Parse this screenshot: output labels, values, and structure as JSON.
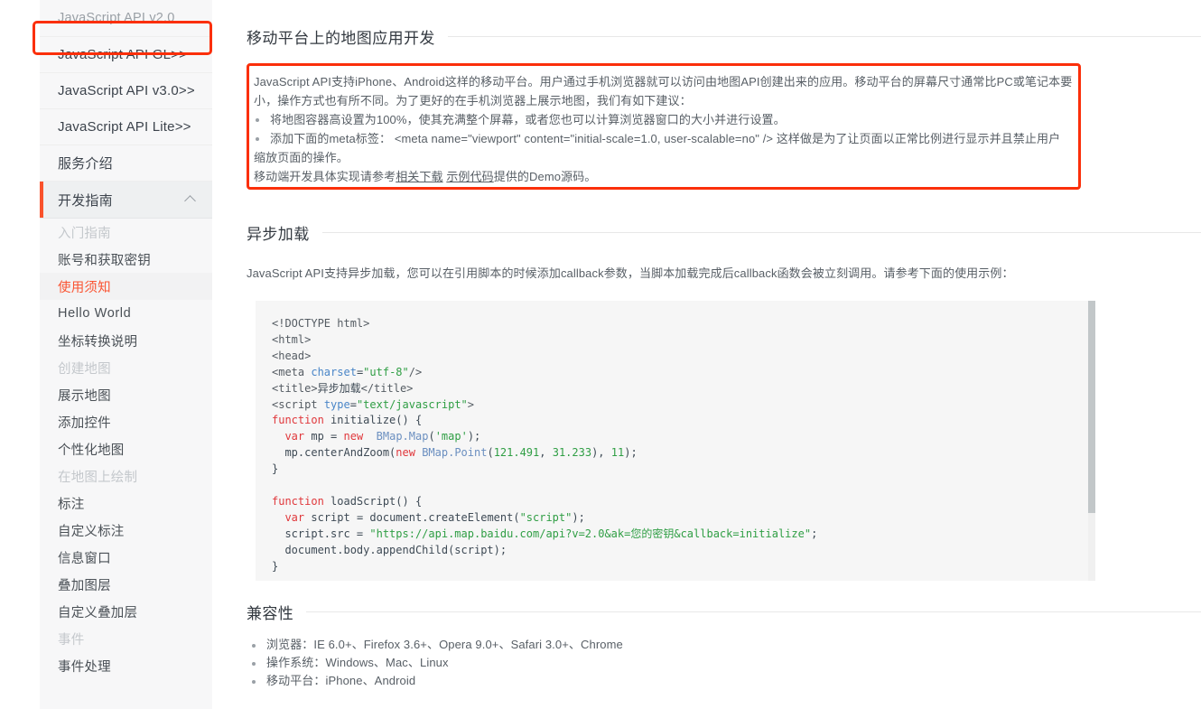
{
  "sidebar": {
    "version_title": "JavaScript API v2.0",
    "top_links": [
      {
        "label": "JavaScript API GL>>"
      },
      {
        "label": "JavaScript API v3.0>>"
      },
      {
        "label": "JavaScript API Lite>>"
      },
      {
        "label": "服务介绍"
      }
    ],
    "section": {
      "label": "开发指南",
      "chevron": "chevron-up"
    },
    "items": [
      {
        "label": "入门指南",
        "state": "dim"
      },
      {
        "label": "账号和获取密钥",
        "state": "normal"
      },
      {
        "label": "使用须知",
        "state": "active"
      },
      {
        "label": "Hello World",
        "state": "latin"
      },
      {
        "label": "坐标转换说明",
        "state": "normal"
      },
      {
        "label": "创建地图",
        "state": "dim"
      },
      {
        "label": "展示地图",
        "state": "normal"
      },
      {
        "label": "添加控件",
        "state": "normal"
      },
      {
        "label": "个性化地图",
        "state": "normal"
      },
      {
        "label": "在地图上绘制",
        "state": "dim"
      },
      {
        "label": "标注",
        "state": "normal"
      },
      {
        "label": "自定义标注",
        "state": "normal"
      },
      {
        "label": "信息窗口",
        "state": "normal"
      },
      {
        "label": "叠加图层",
        "state": "normal"
      },
      {
        "label": "自定义叠加层",
        "state": "normal"
      },
      {
        "label": "事件",
        "state": "dim"
      },
      {
        "label": "事件处理",
        "state": "normal"
      }
    ]
  },
  "main": {
    "mobile_section": {
      "title": "移动平台上的地图应用开发",
      "para_line1": "JavaScript API支持iPhone、Android这样的移动平台。用户通过手机浏览器就可以访问由地图API创建出来的应用。移动平台的屏幕尺寸通常比PC或笔记本要",
      "para_line2": "小，操作方式也有所不同。为了更好的在手机浏览器上展示地图，我们有如下建议：",
      "bullets": [
        "将地图容器高设置为100%，使其充满整个屏幕，或者您也可以计算浏览器窗口的大小并进行设置。",
        "添加下面的meta标签： <meta name=\"viewport\" content=\"initial-scale=1.0, user-scalable=no\" /> 这样做是为了让页面以正常比例进行显示并且禁止用户"
      ],
      "after_bullets": "缩放页面的操作。",
      "note_prefix": "移动端开发具体实现请参考",
      "note_link1": "相关下载",
      "note_sep": " ",
      "note_link2": "示例代码",
      "note_suffix": "提供的Demo源码。"
    },
    "async_section": {
      "title": "异步加载",
      "para": "JavaScript API支持异步加载，您可以在引用脚本的时候添加callback参数，当脚本加载完成后callback函数会被立刻调用。请参考下面的使用示例："
    },
    "code": {
      "lines": [
        "<!DOCTYPE html>",
        "<html>",
        "<head>",
        "<meta charset=\"utf-8\"/>",
        "<title>异步加载</title>",
        "<script type=\"text/javascript\">",
        "function initialize() {",
        "  var mp = new BMap.Map('map');",
        "  mp.centerAndZoom(new BMap.Point(121.491, 31.233), 11);",
        "}",
        "",
        "function loadScript() {",
        "  var script = document.createElement(\"script\");",
        "  script.src = \"https://api.map.baidu.com/api?v=2.0&ak=您的密钥&callback=initialize\";",
        "  document.body.appendChild(script);",
        "}"
      ]
    },
    "compat_section": {
      "title": "兼容性",
      "items": [
        "浏览器：IE 6.0+、Firefox 3.6+、Opera 9.0+、Safari 3.0+、Chrome",
        "操作系统：Windows、Mac、Linux",
        "移动平台：iPhone、Android"
      ]
    }
  },
  "colors": {
    "accent_red": "#fa5331",
    "annotation_red": "#fb2f0a",
    "sidebar_bg": "#f7f7f8",
    "code_bg": "#f6f6f6"
  }
}
